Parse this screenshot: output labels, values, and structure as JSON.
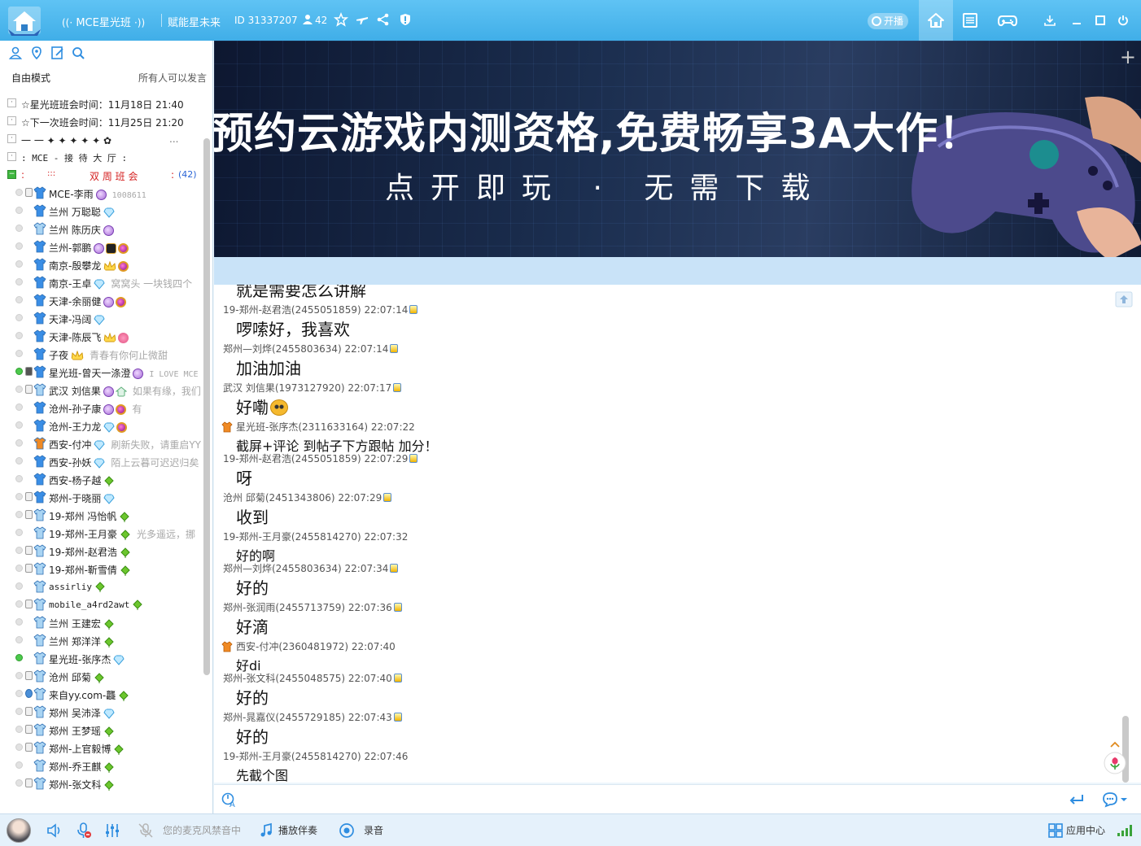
{
  "window": {
    "channel_name": "MCE星光班",
    "channel_prefix": "((·",
    "channel_suffix": "·))",
    "slogan": "赋能星未来",
    "channel_id": "ID 31337207",
    "online_count": "42",
    "live_label": "开播"
  },
  "sidebar": {
    "mode_label": "自由模式",
    "permission_label": "所有人可以发言",
    "notices": [
      "☆星光班班会时间：11月18日 21:40",
      "☆下一次班会时间：11月25日 21:20",
      "一 一 ✦ ✦ ✦ ✦ ✦ ✿",
      ":    MCE  - 接 待 大 厅    :"
    ],
    "notice_extra": "...",
    "active_channel": {
      "prefix": ":",
      "dots": ":::",
      "name": "双 周 班 会",
      "suffix": ":",
      "count": "(42)"
    },
    "users": [
      {
        "name": "MCE-李雨",
        "sig": "1008611",
        "badges": [
          "purple"
        ],
        "online": false,
        "shirt": "#3a8ee6",
        "mic": "normal"
      },
      {
        "name": "兰州  万聪聪",
        "sig": "",
        "badges": [
          "diamond"
        ],
        "online": false,
        "shirt": "#3a8ee6",
        "mic": "none"
      },
      {
        "name": "兰州 陈历庆",
        "sig": "",
        "badges": [
          "purple"
        ],
        "online": false,
        "shirt": "#a9d4f3",
        "mic": "none"
      },
      {
        "name": "兰州-郭鹏",
        "sig": "",
        "badges": [
          "purple",
          "shield",
          "orb"
        ],
        "online": false,
        "shirt": "#3a8ee6",
        "mic": "none"
      },
      {
        "name": "南京-殷攀龙",
        "sig": "",
        "badges": [
          "crown",
          "orb"
        ],
        "online": false,
        "shirt": "#3a8ee6",
        "mic": "none"
      },
      {
        "name": "南京-王卓",
        "sig": "窝窝头 一块钱四个",
        "badges": [
          "diamond"
        ],
        "online": false,
        "shirt": "#3a8ee6",
        "mic": "none"
      },
      {
        "name": "天津-余丽健",
        "sig": "",
        "badges": [
          "purple",
          "orb"
        ],
        "online": false,
        "shirt": "#3a8ee6",
        "mic": "none"
      },
      {
        "name": "天津-冯阔",
        "sig": "",
        "badges": [
          "diamond"
        ],
        "online": false,
        "shirt": "#3a8ee6",
        "mic": "none"
      },
      {
        "name": "天津-陈辰飞",
        "sig": "",
        "badges": [
          "crown",
          "flower"
        ],
        "online": false,
        "shirt": "#3a8ee6",
        "mic": "none"
      },
      {
        "name": "子夜",
        "sig": "青春有你何止微甜",
        "badges": [
          "crown"
        ],
        "online": false,
        "shirt": "#3a8ee6",
        "mic": "none"
      },
      {
        "name": "星光班-曾天一涤澄",
        "sig": "I LOVE MCE",
        "badges": [
          "purple"
        ],
        "online": true,
        "shirt": "#3a8ee6",
        "mic": "dark"
      },
      {
        "name": "武汉 刘信果",
        "sig": "如果有缘，我们",
        "badges": [
          "purple",
          "house"
        ],
        "online": false,
        "shirt": "#a9d4f3",
        "mic": "normal"
      },
      {
        "name": "沧州-孙子康",
        "sig": "有",
        "badges": [
          "purple",
          "orb"
        ],
        "online": false,
        "shirt": "#3a8ee6",
        "mic": "none"
      },
      {
        "name": "沧州-王力龙",
        "sig": "",
        "badges": [
          "diamond",
          "orb"
        ],
        "online": false,
        "shirt": "#3a8ee6",
        "mic": "none"
      },
      {
        "name": "西安-付冲",
        "sig": "刷新失败，请重启YY",
        "badges": [
          "diamond"
        ],
        "online": false,
        "shirt": "#f08a24",
        "mic": "none"
      },
      {
        "name": "西安-孙妖",
        "sig": "陌上云暮可迟迟归矣",
        "badges": [
          "diamond"
        ],
        "online": false,
        "shirt": "#3a8ee6",
        "mic": "none"
      },
      {
        "name": "西安-杨子越",
        "sig": "",
        "badges": [
          "leaf"
        ],
        "online": false,
        "shirt": "#3a8ee6",
        "mic": "none"
      },
      {
        "name": "郑州-于晓丽",
        "sig": "",
        "badges": [
          "diamond"
        ],
        "online": false,
        "shirt": "#3a8ee6",
        "mic": "normal"
      },
      {
        "name": "19-郑州  冯怡帆",
        "sig": "",
        "badges": [
          "leaf"
        ],
        "online": false,
        "shirt": "#a9d4f3",
        "mic": "normal"
      },
      {
        "name": "19-郑州-王月豪",
        "sig": "光多遥远，挪",
        "badges": [
          "leaf"
        ],
        "online": false,
        "shirt": "#a9d4f3",
        "mic": "none"
      },
      {
        "name": "19-郑州-赵君浩",
        "sig": "",
        "badges": [
          "leaf"
        ],
        "online": false,
        "shirt": "#a9d4f3",
        "mic": "normal"
      },
      {
        "name": "19-郑州-靳雪倩",
        "sig": "",
        "badges": [
          "leaf"
        ],
        "online": false,
        "shirt": "#a9d4f3",
        "mic": "normal"
      },
      {
        "name": "assirliy",
        "sig": "",
        "badges": [
          "leaf"
        ],
        "online": false,
        "shirt": "#a9d4f3",
        "mic": "none"
      },
      {
        "name": "mobile_a4rd2awt",
        "sig": "",
        "badges": [
          "leaf"
        ],
        "online": false,
        "shirt": "#a9d4f3",
        "mic": "normal"
      },
      {
        "name": "兰州  王建宏",
        "sig": "",
        "badges": [
          "leaf"
        ],
        "online": false,
        "shirt": "#a9d4f3",
        "mic": "none"
      },
      {
        "name": "兰州 郑洋洋",
        "sig": "",
        "badges": [
          "leaf"
        ],
        "online": false,
        "shirt": "#a9d4f3",
        "mic": "none"
      },
      {
        "name": "星光班-张序杰",
        "sig": "",
        "badges": [
          "diamond"
        ],
        "online": true,
        "shirt": "#a9d4f3",
        "mic": "none"
      },
      {
        "name": "沧州 邱菊",
        "sig": "",
        "badges": [
          "leaf"
        ],
        "online": false,
        "shirt": "#a9d4f3",
        "mic": "normal"
      },
      {
        "name": "来自yy.com-龘",
        "sig": "",
        "badges": [
          "leaf"
        ],
        "online": false,
        "shirt": "#a9d4f3",
        "mic": "yy"
      },
      {
        "name": "郑州 吴沛泽",
        "sig": "",
        "badges": [
          "diamond"
        ],
        "online": false,
        "shirt": "#a9d4f3",
        "mic": "normal"
      },
      {
        "name": "郑州 王梦瑶",
        "sig": "",
        "badges": [
          "leaf"
        ],
        "online": false,
        "shirt": "#a9d4f3",
        "mic": "normal"
      },
      {
        "name": "郑州-上官毅博",
        "sig": "",
        "badges": [
          "leaf"
        ],
        "online": false,
        "shirt": "#a9d4f3",
        "mic": "normal"
      },
      {
        "name": "郑州-乔王麒",
        "sig": "",
        "badges": [
          "leaf"
        ],
        "online": false,
        "shirt": "#a9d4f3",
        "mic": "none"
      },
      {
        "name": "郑州-张文科",
        "sig": "",
        "badges": [
          "leaf"
        ],
        "online": false,
        "shirt": "#a9d4f3",
        "mic": "normal"
      }
    ]
  },
  "banner": {
    "headline": "预约云游戏内测资格,免费畅享3A大作！",
    "subline": "点开即玩 · 无需下载"
  },
  "chat": {
    "messages": [
      {
        "head": "",
        "body": "就是需要怎么讲解",
        "size": "big",
        "gift": false,
        "pm": false
      },
      {
        "head": "19-郑州-赵君浩(2455051859) 22:07:14",
        "body": "啰嗦好，我喜欢",
        "size": "big",
        "gift": false,
        "pm": true
      },
      {
        "head": "郑州—刘烨(2455803634) 22:07:14",
        "body": "加油加油",
        "size": "big",
        "gift": false,
        "pm": true
      },
      {
        "head": "武汉 刘信果(1973127920) 22:07:17",
        "body": "好嘞",
        "size": "big",
        "gift": false,
        "pm": true,
        "emoji": true
      },
      {
        "head": "星光班-张序杰(2311633164) 22:07:22",
        "body": "截屏+评论 到帖子下方跟帖 加分！",
        "size": "mid",
        "gift": true,
        "pm": false
      },
      {
        "head": "19-郑州-赵君浩(2455051859) 22:07:29",
        "body": "呀",
        "size": "big",
        "gift": false,
        "pm": true
      },
      {
        "head": "沧州 邱菊(2451343806) 22:07:29",
        "body": "收到",
        "size": "big",
        "gift": false,
        "pm": true
      },
      {
        "head": "19-郑州-王月豪(2455814270) 22:07:32",
        "body": "好的啊",
        "size": "mid",
        "gift": false,
        "pm": false
      },
      {
        "head": "郑州—刘烨(2455803634) 22:07:34",
        "body": "好的",
        "size": "big",
        "gift": false,
        "pm": true
      },
      {
        "head": "郑州-张润雨(2455713759) 22:07:36",
        "body": "好滴",
        "size": "big",
        "gift": false,
        "pm": true
      },
      {
        "head": "西安-付冲(2360481972) 22:07:40",
        "body": "好di",
        "size": "mid",
        "gift": true,
        "pm": false
      },
      {
        "head": "郑州-张文科(2455048575) 22:07:40",
        "body": "好的",
        "size": "big",
        "gift": false,
        "pm": true
      },
      {
        "head": "郑州-晁嘉仪(2455729185) 22:07:43",
        "body": "好的",
        "size": "big",
        "gift": false,
        "pm": true
      },
      {
        "head": "19-郑州-王月豪(2455814270) 22:07:46",
        "body": "先截个图",
        "size": "mid",
        "gift": false,
        "pm": false
      }
    ]
  },
  "bottombar": {
    "mic_status": "您的麦克风禁音中",
    "accompany": "播放伴奏",
    "record": "录音",
    "app_center": "应用中心"
  },
  "colors": {
    "titlebar": "#4db7ee",
    "accent_blue": "#2e8de0",
    "online_green": "#4cc94c",
    "channel_red": "#d42020"
  }
}
